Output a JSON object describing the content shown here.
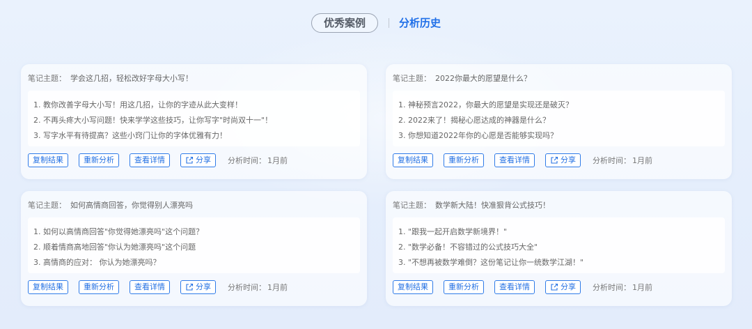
{
  "tabs": {
    "cases_label": "优秀案例",
    "history_label": "分析历史"
  },
  "common": {
    "subject_label": "笔记主题：",
    "copy_label": "复制结果",
    "reanalyze_label": "重新分析",
    "details_label": "查看详情",
    "share_label": "分享",
    "time_label": "分析时间：",
    "share_icon": "share-icon",
    "accent": "#1f6fe8"
  },
  "cards": [
    {
      "subject": "学会这几招，轻松改好字母大小写！",
      "items": [
        "1. 教你改善字母大小写！用这几招，让你的字迹从此大变样！",
        "2. 不再头疼大小写问题！快来学学这些技巧，让你写字\"时尚双十一\"！",
        "3. 写字水平有待提高？这些小窍门让你的字体优雅有力！"
      ],
      "time": "1月前"
    },
    {
      "subject": "2022你最大的愿望是什么？",
      "items": [
        "1. 神秘预言2022，你最大的愿望是实现还是破灭？",
        "2. 2022来了！揭秘心愿达成的神器是什么？",
        "3. 你想知道2022年你的心愿是否能够实现吗？"
      ],
      "time": "1月前"
    },
    {
      "subject": "如何高情商回答，你觉得别人漂亮吗",
      "items": [
        "1. 如何以高情商回答\"你觉得她漂亮吗\"这个问题？",
        "2. 顺着情商高地回答\"你认为她漂亮吗\"这个问题",
        "3. 高情商的应对：  你认为她漂亮吗？"
      ],
      "time": "1月前"
    },
    {
      "subject": "数学新大陆！快准狠背公式技巧！",
      "items": [
        "1. \"跟我一起开启数学新境界！\"",
        "2. \"数学必备！不容错过的公式技巧大全\"",
        "3. \"不想再被数学难倒？这份笔记让你一统数学江湖！\""
      ],
      "time": "1月前"
    }
  ]
}
